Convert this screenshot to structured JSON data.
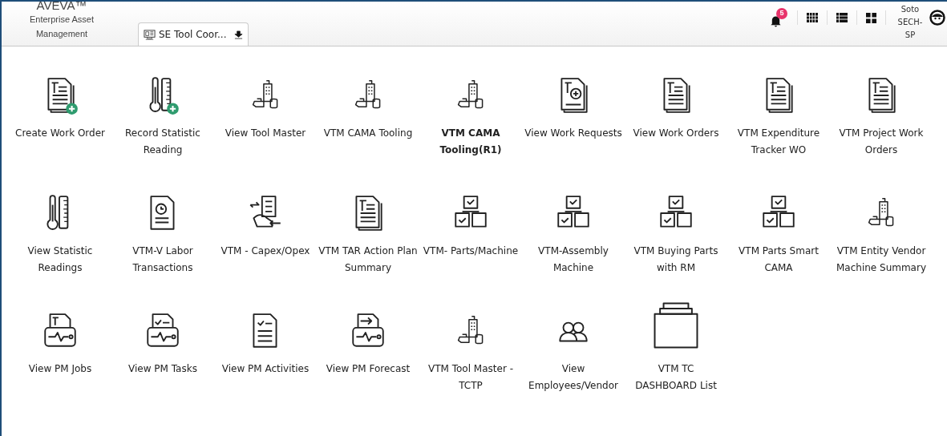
{
  "header": {
    "brand": "AVEVA™",
    "product": "Enterprise Asset Management",
    "tab": {
      "label": "SE Tool Coor..."
    },
    "notifications": {
      "count": "5"
    },
    "user": "Soto SECH-SP"
  },
  "tiles": [
    {
      "label": "Create Work Order",
      "selected": false
    },
    {
      "label": "Record Statistic Reading",
      "selected": false
    },
    {
      "label": "View Tool Master",
      "selected": false
    },
    {
      "label": "VTM CAMA Tooling",
      "selected": false
    },
    {
      "label": "VTM CAMA Tooling(R1)",
      "selected": true
    },
    {
      "label": "View Work Requests",
      "selected": false
    },
    {
      "label": "View Work Orders",
      "selected": false
    },
    {
      "label": "VTM Expenditure Tracker WO",
      "selected": false
    },
    {
      "label": "VTM Project Work Orders",
      "selected": false
    },
    {
      "label": "View Statistic Readings",
      "selected": false
    },
    {
      "label": "VTM-V Labor Transactions",
      "selected": false
    },
    {
      "label": "VTM - Capex/Opex",
      "selected": false
    },
    {
      "label": "VTM TAR Action Plan Summary",
      "selected": false
    },
    {
      "label": "VTM- Parts/Machine",
      "selected": false
    },
    {
      "label": "VTM-Assembly Machine",
      "selected": false
    },
    {
      "label": "VTM Buying Parts with RM",
      "selected": false
    },
    {
      "label": "VTM Parts Smart CAMA",
      "selected": false
    },
    {
      "label": "VTM Entity Vendor Machine Summary",
      "selected": false
    },
    {
      "label": "View PM Jobs",
      "selected": false
    },
    {
      "label": "View PM Tasks",
      "selected": false
    },
    {
      "label": "View PM Activities",
      "selected": false
    },
    {
      "label": "View PM Forecast",
      "selected": false
    },
    {
      "label": "VTM Tool Master - TCTP",
      "selected": false
    },
    {
      "label": "View Employees/Vendor",
      "selected": false
    },
    {
      "label": "VTM TC DASHBOARD List",
      "selected": false
    }
  ]
}
